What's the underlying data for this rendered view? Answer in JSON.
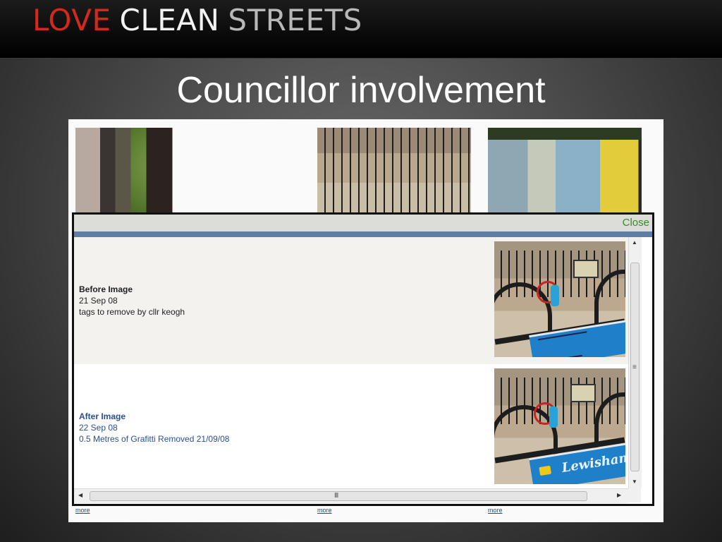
{
  "banner": {
    "logo_word_1": "LOVE",
    "logo_word_2": "CLEAN",
    "logo_word_3": "STREETS",
    "colors": {
      "love": "#d12a1c",
      "clean": "#f2f2f2",
      "streets": "#b8b8b8"
    }
  },
  "slide": {
    "title": "Councillor involvement"
  },
  "gallery": {
    "link_label": "more"
  },
  "modal": {
    "close_label": "Close",
    "before": {
      "heading": "Before Image",
      "date": "21 Sep 08",
      "description": "tags to remove by cllr keogh"
    },
    "after": {
      "heading": "After Image",
      "date": "22 Sep 08",
      "description": "0.5 Metres of Grafitti Removed 21/09/08",
      "sign_text": "Lewisham"
    },
    "scrollbar": {
      "vertical_grip": "≡",
      "horizontal_grip": "III",
      "up_arrow": "▲",
      "down_arrow": "▼",
      "left_arrow": "◀",
      "right_arrow": "▶"
    }
  }
}
